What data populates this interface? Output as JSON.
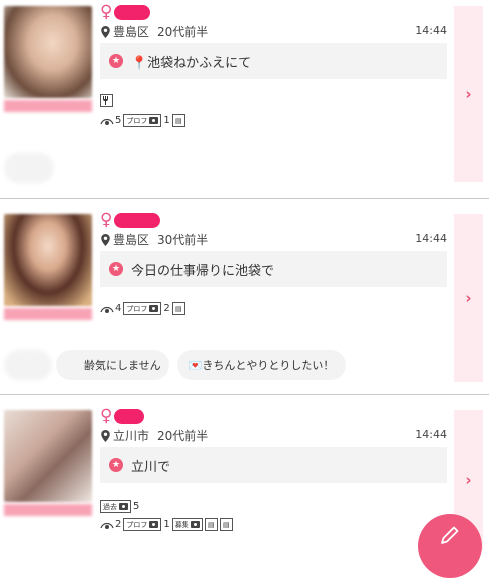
{
  "posts": [
    {
      "area": "豊島区",
      "age": "20代前半",
      "time": "14:44",
      "message": "📍池袋ねかふえにて",
      "views": "5",
      "photos": "1",
      "profile_label": "プロフ"
    },
    {
      "area": "豊島区",
      "age": "30代前半",
      "time": "14:44",
      "message": "今日の仕事帰りに池袋で",
      "views": "4",
      "photos": "2",
      "profile_label": "プロフ"
    },
    {
      "area": "立川市",
      "age": "20代前半",
      "time": "14:44",
      "message": "立川で",
      "past_label": "過去",
      "past_count": "5",
      "views": "2",
      "photos": "1",
      "profile_label": "プロフ",
      "recruit_label": "募集"
    }
  ],
  "tags": {
    "tag_age": "齢気にしません",
    "tag_polite": "💌きちんとやりとりしたい！"
  },
  "icons": {
    "female": "female-symbol-icon",
    "location": "location-pin-icon",
    "arrow": "chevron-right-icon",
    "compose": "pencil-icon"
  },
  "colors": {
    "accent": "#ef5a79",
    "name_blob": "#f2236a",
    "side_bg": "#fdebef"
  }
}
